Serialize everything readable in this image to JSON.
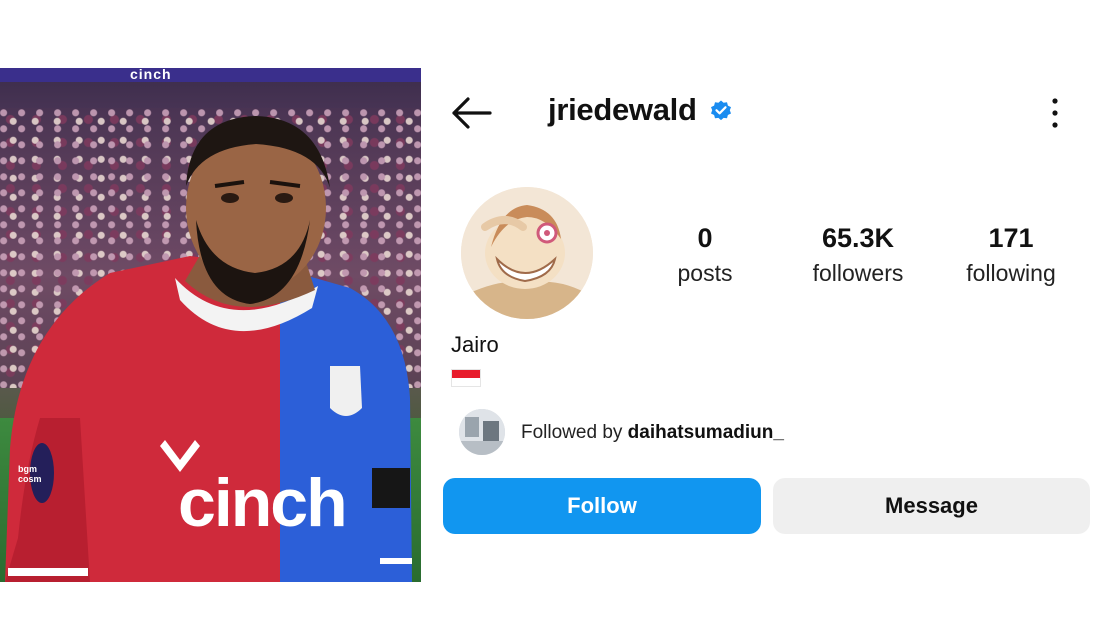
{
  "photo": {
    "stand_banner_text": "cinch",
    "shirt_sponsor": "cinch",
    "sleeve_badge_text": "bgm cosm"
  },
  "profile": {
    "username": "jriedewald",
    "verified": true,
    "display_name": "Jairo",
    "bio_flag": "Indonesia flag",
    "stats": {
      "posts": {
        "value": "0",
        "label": "posts"
      },
      "followers": {
        "value": "65.3K",
        "label": "followers"
      },
      "following": {
        "value": "171",
        "label": "following"
      }
    },
    "followed_by": {
      "prefix": "Followed by",
      "username": "daihatsumadiun_"
    },
    "buttons": {
      "follow": "Follow",
      "message": "Message"
    }
  },
  "colors": {
    "follow_button": "#1196f0",
    "message_button": "#efefef",
    "verified_badge": "#1a8cf0",
    "jersey_red": "#d42a3a",
    "jersey_blue": "#2a5bd7"
  },
  "icons": {
    "back": "back-arrow-icon",
    "verified": "verified-badge-icon",
    "more": "more-options-icon"
  }
}
